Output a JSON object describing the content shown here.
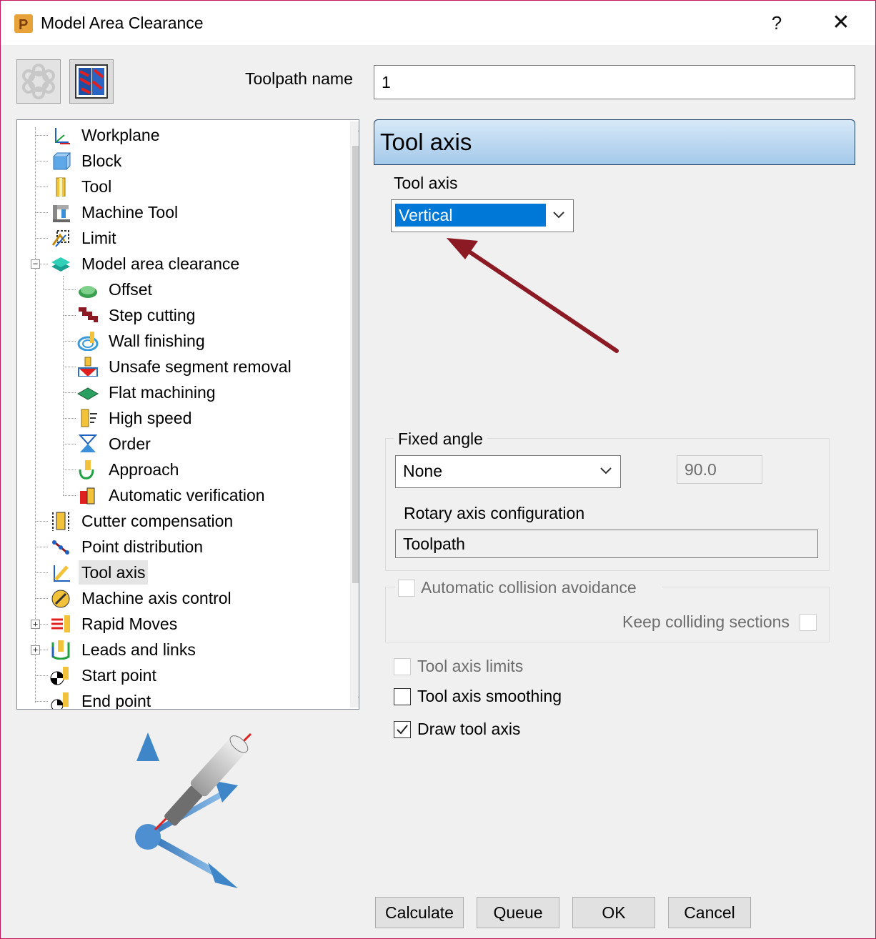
{
  "window": {
    "title": "Model Area Clearance",
    "help_label": "?",
    "close_label": "✕"
  },
  "toolpath_name": {
    "label": "Toolpath name",
    "value": "1"
  },
  "tree": {
    "items": [
      {
        "label": "Workplane",
        "icon": "workplane-icon"
      },
      {
        "label": "Block",
        "icon": "block-icon"
      },
      {
        "label": "Tool",
        "icon": "tool-icon"
      },
      {
        "label": "Machine Tool",
        "icon": "machine-tool-icon"
      },
      {
        "label": "Limit",
        "icon": "limit-icon"
      },
      {
        "label": "Model area clearance",
        "icon": "model-area-clearance-icon",
        "expander": "−"
      },
      {
        "label": "Offset",
        "icon": "offset-icon"
      },
      {
        "label": "Step cutting",
        "icon": "step-cutting-icon"
      },
      {
        "label": "Wall finishing",
        "icon": "wall-finishing-icon"
      },
      {
        "label": "Unsafe segment removal",
        "icon": "unsafe-segment-removal-icon"
      },
      {
        "label": "Flat machining",
        "icon": "flat-machining-icon"
      },
      {
        "label": "High speed",
        "icon": "high-speed-icon"
      },
      {
        "label": "Order",
        "icon": "order-icon"
      },
      {
        "label": "Approach",
        "icon": "approach-icon"
      },
      {
        "label": "Automatic verification",
        "icon": "automatic-verification-icon"
      },
      {
        "label": "Cutter compensation",
        "icon": "cutter-compensation-icon"
      },
      {
        "label": "Point distribution",
        "icon": "point-distribution-icon"
      },
      {
        "label": "Tool axis",
        "icon": "tool-axis-icon",
        "selected": true
      },
      {
        "label": "Machine axis control",
        "icon": "machine-axis-control-icon"
      },
      {
        "label": "Rapid Moves",
        "icon": "rapid-moves-icon",
        "expander": "+"
      },
      {
        "label": "Leads and links",
        "icon": "leads-and-links-icon",
        "expander": "+"
      },
      {
        "label": "Start point",
        "icon": "start-point-icon"
      },
      {
        "label": "End point",
        "icon": "end-point-icon"
      }
    ]
  },
  "panel": {
    "header": "Tool axis",
    "tool_axis_label": "Tool axis",
    "tool_axis_value": "Vertical",
    "fixed_angle_label": "Fixed angle",
    "fixed_angle_value": "None",
    "angle_value": "90.0",
    "rotary_label": "Rotary axis configuration",
    "rotary_value": "Toolpath",
    "auto_collision_label": "Automatic collision avoidance",
    "keep_colliding_label": "Keep colliding sections",
    "tool_axis_limits_label": "Tool axis limits",
    "tool_axis_smoothing_label": "Tool axis smoothing",
    "draw_tool_axis_label": "Draw tool axis",
    "draw_tool_axis_checked": true
  },
  "buttons": {
    "calculate": "Calculate",
    "queue": "Queue",
    "ok": "OK",
    "cancel": "Cancel"
  },
  "colors": {
    "accent": "#0078d7",
    "annotation_arrow": "#8b1a24",
    "window_border": "#c2185b"
  }
}
